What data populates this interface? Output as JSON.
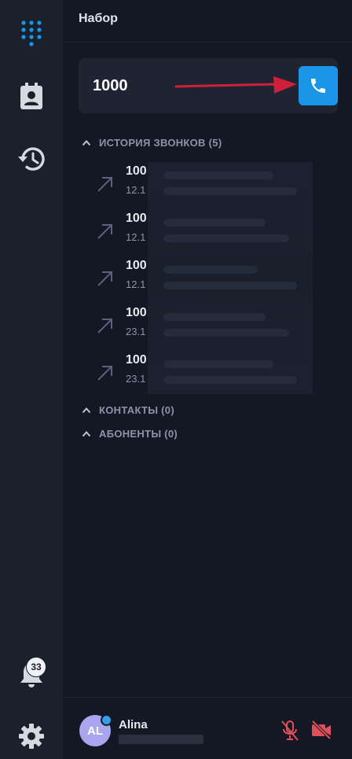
{
  "header": {
    "title": "Набор"
  },
  "dialer": {
    "value": "1000"
  },
  "history": {
    "heading": "ИСТОРИЯ ЗВОНКОВ (5)",
    "items": [
      {
        "number": "100",
        "date": "12.1"
      },
      {
        "number": "100",
        "date": "12.1"
      },
      {
        "number": "100",
        "date": "12.1"
      },
      {
        "number": "100",
        "date": "23.1"
      },
      {
        "number": "100",
        "date": "23.1"
      }
    ]
  },
  "contacts": {
    "heading": "КОНТАКТЫ (0)"
  },
  "subscribers": {
    "heading": "АБОНЕНТЫ (0)"
  },
  "notifications": {
    "count": "33"
  },
  "user": {
    "initials": "AL",
    "name": "Alina"
  },
  "colors": {
    "accent": "#1a95e8",
    "sidebar": "#1b202d",
    "background": "#141824",
    "danger": "#e0505a",
    "arrow": "#d01f3a"
  },
  "icons": {
    "sidebar": [
      "dialpad-icon",
      "contacts-icon",
      "history-icon",
      "bell-icon",
      "gear-icon"
    ],
    "call": "phone-icon",
    "row": "outgoing-call-icon",
    "footer": [
      "mic-off-icon",
      "video-off-icon"
    ]
  }
}
